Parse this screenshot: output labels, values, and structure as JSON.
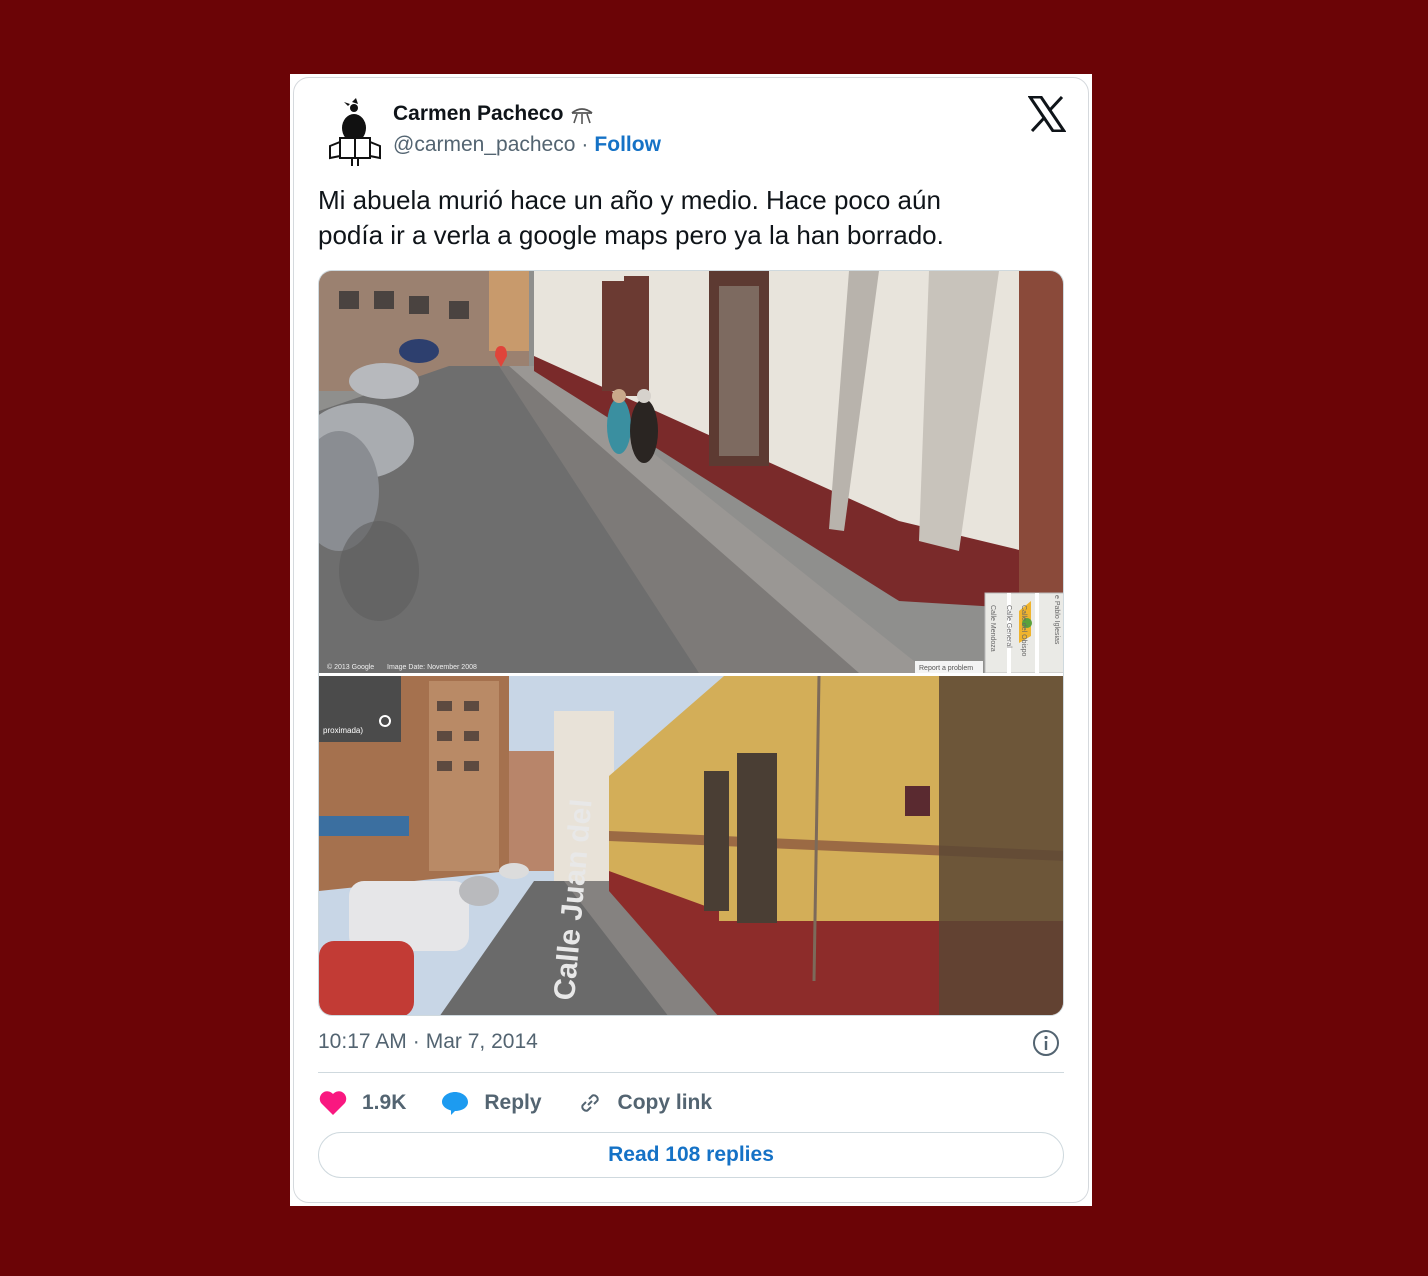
{
  "author": {
    "name": "Carmen Pacheco",
    "handle": "@carmen_pacheco",
    "separator": "·",
    "follow_label": "Follow"
  },
  "tweet": {
    "text_line1": "Mi abuela murió hace un año y medio. Hace poco aún",
    "text_line2": "podía ir a verla a google maps pero ya la han borrado."
  },
  "media": {
    "top_image": {
      "copyright": "© 2013 Google",
      "image_date": "Image Date: November 2008",
      "report_link": "Report a problem",
      "minimap_labels": [
        "Calle Mendoza",
        "Calle General",
        "Calle del Obispo",
        "e Pablo Iglesias"
      ]
    },
    "bottom_image": {
      "location_chip": "proximada)",
      "street_label": "Calle Juan del"
    }
  },
  "meta": {
    "time": "10:17 AM",
    "separator": "·",
    "date": "Mar 7, 2014"
  },
  "actions": {
    "like_count": "1.9K",
    "reply_label": "Reply",
    "copy_label": "Copy link"
  },
  "read_replies_label": "Read 108 replies",
  "colors": {
    "background": "#6b0406",
    "link_blue": "#1572c6",
    "heart_pink": "#f91880",
    "reply_blue": "#1d9bf0",
    "muted_text": "#536471"
  }
}
